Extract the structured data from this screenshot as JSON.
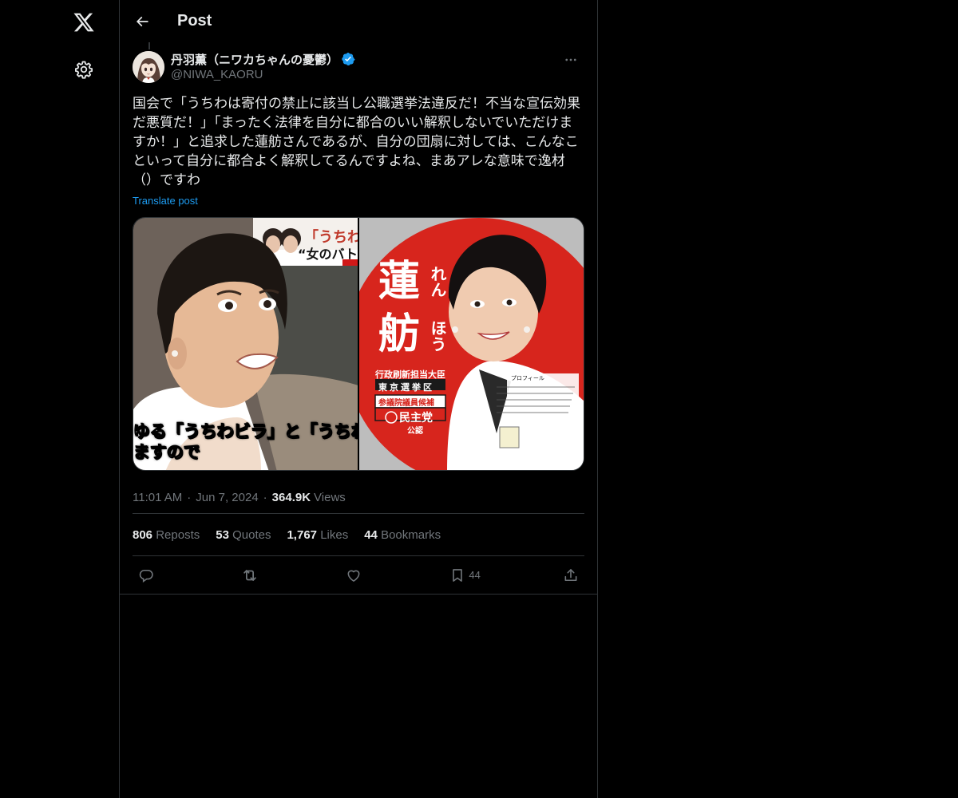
{
  "nav": {
    "logo_icon": "x-logo-icon",
    "settings_icon": "gear-icon"
  },
  "header": {
    "title": "Post",
    "back_icon": "arrow-left-icon"
  },
  "tweet": {
    "author": {
      "name": "丹羽薫（ニワカちゃんの憂鬱）",
      "handle": "@NIWA_KAORU",
      "verified": true
    },
    "text": "国会で「うちわは寄付の禁止に該当し公職選挙法違反だ！不当な宣伝効果だ悪質だ！」「まったく法律を自分に都合のいい解釈しないでいただけますか！」と追求した蓮舫さんであるが、自分の団扇に対しては、こんなこといって自分に都合よく解釈してるんですよね、まあアレな意味で逸材（）ですわ",
    "translate_label": "Translate post",
    "media": {
      "left_caption_top": "「うちわ",
      "left_caption_sub": "“女のバト",
      "left_subtitle_line1": "ゆる「うちわビラ」と「うちわ",
      "left_subtitle_line2": "ますので",
      "right_name_big1": "蓮",
      "right_name_big2": "舫",
      "right_name_kana1": "れん",
      "right_name_kana2": "ほう",
      "right_role": "行政刷新担当大臣",
      "right_district": "東京選挙区",
      "right_candidate": "参議院議員候補",
      "right_party": "民主党",
      "right_endorse": "公認",
      "right_profile": "プロフィール"
    },
    "time": "11:01 AM",
    "date": "Jun 7, 2024",
    "views_count": "364.9K",
    "views_label": "Views",
    "stats": {
      "reposts_count": "806",
      "reposts_label": "Reposts",
      "quotes_count": "53",
      "quotes_label": "Quotes",
      "likes_count": "1,767",
      "likes_label": "Likes",
      "bookmarks_count": "44",
      "bookmarks_label": "Bookmarks"
    },
    "actions": {
      "bookmark_count": "44"
    }
  },
  "colors": {
    "background": "#000000",
    "text": "#e7e9ea",
    "muted": "#71767b",
    "accent": "#1d9bf0",
    "border": "#2f3336"
  }
}
